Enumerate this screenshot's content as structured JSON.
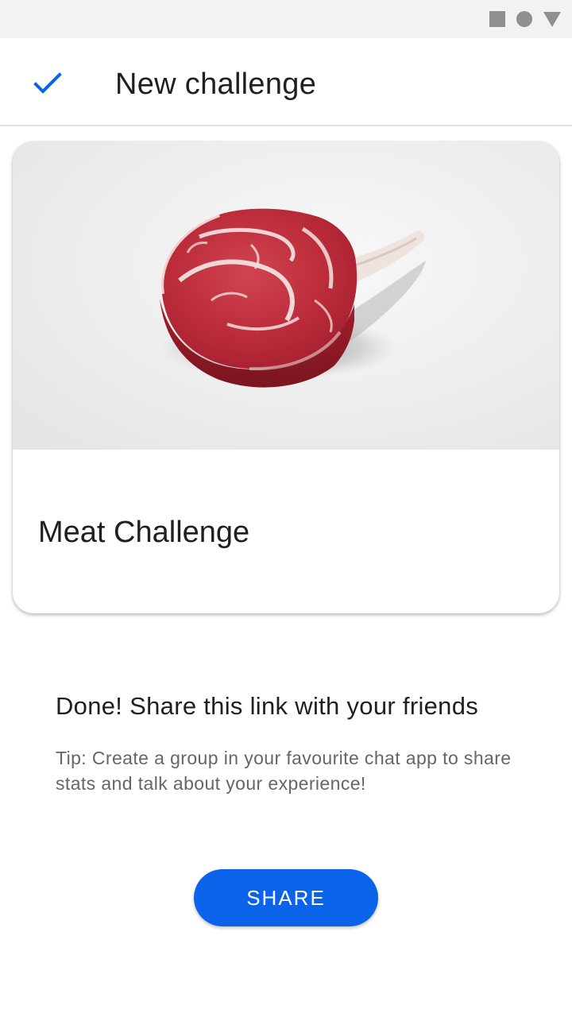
{
  "status_bar": {
    "icons": [
      "square-icon",
      "circle-icon",
      "triangle-icon"
    ],
    "icon_color": "#8f8f8f"
  },
  "app_bar": {
    "leading_icon": "check-icon",
    "title": "New challenge",
    "accent_color": "#0a63e8"
  },
  "card": {
    "image": "raw-ribeye-steak-photo",
    "title": "Meat Challenge"
  },
  "main": {
    "heading": "Done! Share this link with your friends",
    "tip": "Tip: Create a group in your favourite chat app to share stats and talk about your experience!"
  },
  "share_button": {
    "label": "SHARE",
    "color": "#0a63e8"
  }
}
